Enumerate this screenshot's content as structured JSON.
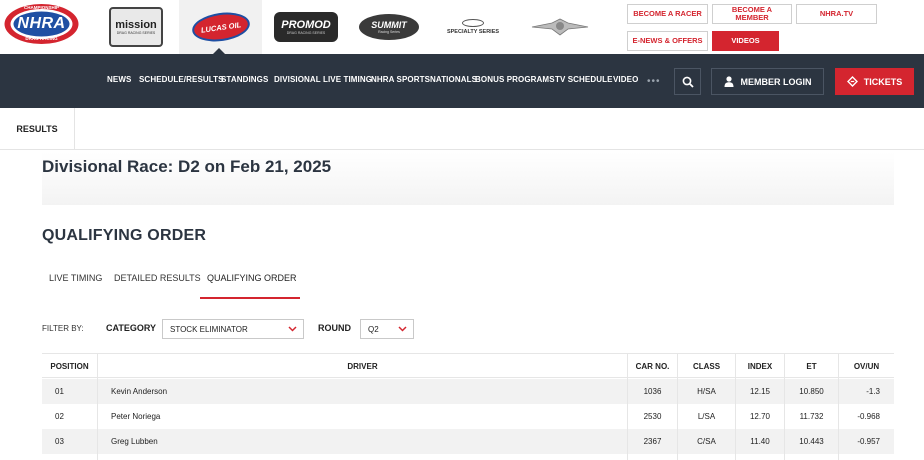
{
  "header": {
    "nhra_logo": {
      "top_text": "CHAMPIONSHIP",
      "main_text": "NHRA",
      "bottom_text": "DRAG RACING"
    },
    "series_logos": [
      {
        "name": "mission-logo",
        "text": "mission",
        "subtext": "DRAG RACING SERIES"
      },
      {
        "name": "lucas-oil-logo",
        "text": "LUCAS OIL"
      },
      {
        "name": "promod-logo",
        "text": "PROMOD",
        "subtext": "DRAG RACING SERIES"
      },
      {
        "name": "summit-logo",
        "text": "SUMMIT",
        "subtext": "Racing Series"
      },
      {
        "name": "specialty-series-logo",
        "text": "SPECIALTY SERIES"
      },
      {
        "name": "heritage-logo",
        "text": ""
      }
    ],
    "utility_buttons": {
      "become_racer": "BECOME A RACER",
      "become_member": "BECOME A MEMBER",
      "nhra_tv": "NHRA.TV",
      "enews": "E-NEWS & OFFERS",
      "videos": "VIDEOS"
    }
  },
  "nav": {
    "items": [
      "NEWS",
      "SCHEDULE/RESULTS",
      "STANDINGS",
      "DIVISIONAL LIVE TIMING",
      "NHRA SPORTSNATIONALS",
      "BONUS PROGRAMS",
      "TV SCHEDULE",
      "VIDEO"
    ],
    "more": "•••",
    "member_login": "MEMBER LOGIN",
    "tickets": "TICKETS"
  },
  "subheader": {
    "results_tab": "RESULTS"
  },
  "race": {
    "title": "Divisional Race: D2 on Feb 21, 2025"
  },
  "section": {
    "title": "QUALIFYING ORDER"
  },
  "tabs": [
    {
      "label": "LIVE TIMING"
    },
    {
      "label": "DETAILED RESULTS"
    },
    {
      "label": "QUALIFYING ORDER",
      "active": true
    }
  ],
  "filters": {
    "filter_by": "FILTER BY:",
    "category_label": "CATEGORY",
    "category_value": "STOCK ELIMINATOR",
    "round_label": "ROUND",
    "round_value": "Q2"
  },
  "table": {
    "columns": [
      "POSITION",
      "DRIVER",
      "CAR NO.",
      "CLASS",
      "INDEX",
      "ET",
      "OV/UN"
    ],
    "rows": [
      {
        "position": "01",
        "driver": "Kevin Anderson",
        "car_no": "1036",
        "class": "H/SA",
        "index": "12.15",
        "et": "10.850",
        "ov_un": "-1.3"
      },
      {
        "position": "02",
        "driver": "Peter Noriega",
        "car_no": "2530",
        "class": "L/SA",
        "index": "12.70",
        "et": "11.732",
        "ov_un": "-0.968"
      },
      {
        "position": "03",
        "driver": "Greg Lubben",
        "car_no": "2367",
        "class": "C/SA",
        "index": "11.40",
        "et": "10.443",
        "ov_un": "-0.957"
      }
    ]
  },
  "colors": {
    "accent": "#d4252f",
    "nav_bg": "#2c3541"
  }
}
